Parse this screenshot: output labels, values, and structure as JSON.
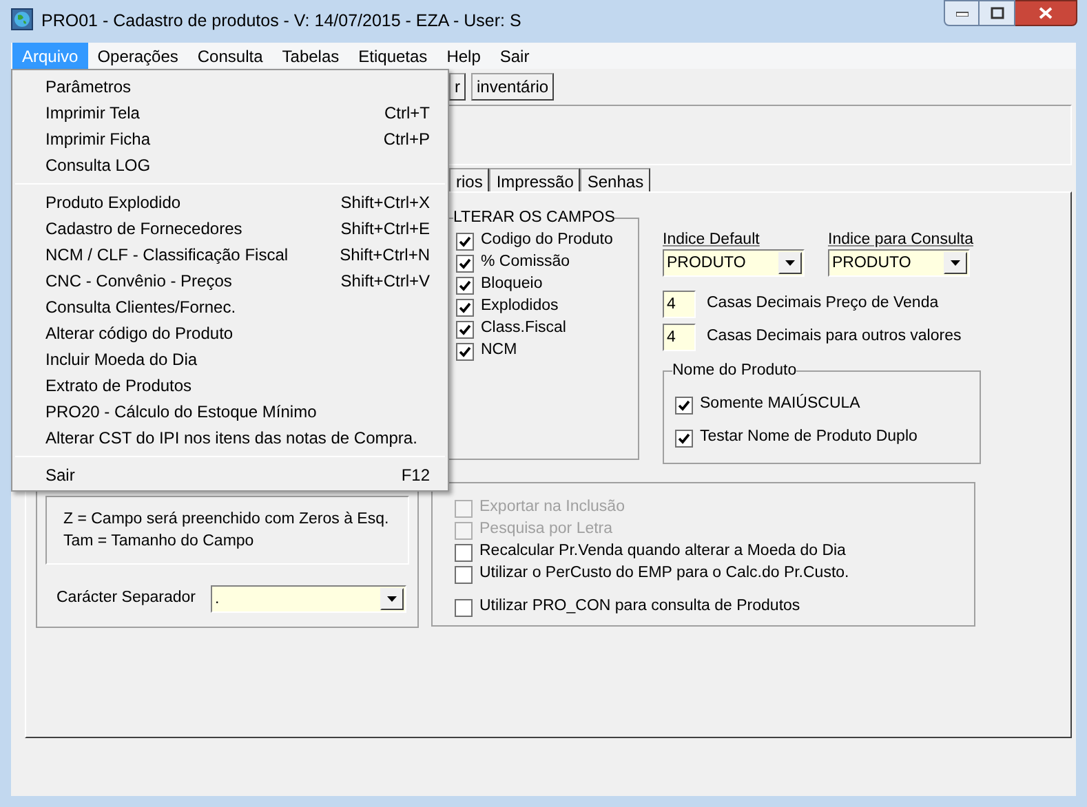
{
  "window": {
    "title": "PRO01 - Cadastro de produtos - V: 14/07/2015 - EZA - User: S"
  },
  "menubar": [
    {
      "label": "Arquivo",
      "selected": true
    },
    {
      "label": "Operações",
      "selected": false
    },
    {
      "label": "Consulta",
      "selected": false
    },
    {
      "label": "Tabelas",
      "selected": false
    },
    {
      "label": "Etiquetas",
      "selected": false
    },
    {
      "label": "Help",
      "selected": false
    },
    {
      "label": "Sair",
      "selected": false
    }
  ],
  "menu": {
    "sections": [
      [
        {
          "label": "Parâmetros"
        },
        {
          "label": "Imprimir Tela",
          "shortcut": "Ctrl+T"
        },
        {
          "label": "Imprimir Ficha",
          "shortcut": "Ctrl+P"
        },
        {
          "label": "Consulta LOG"
        }
      ],
      [
        {
          "label": "Produto Explodido",
          "shortcut": "Shift+Ctrl+X"
        },
        {
          "label": "Cadastro de Fornecedores",
          "shortcut": "Shift+Ctrl+E"
        },
        {
          "label": "NCM / CLF - Classificação Fiscal",
          "shortcut": "Shift+Ctrl+N"
        },
        {
          "label": "CNC - Convênio - Preços",
          "shortcut": "Shift+Ctrl+V"
        },
        {
          "label": "Consulta Clientes/Fornec."
        },
        {
          "label": "Alterar código do Produto"
        },
        {
          "label": "Incluir Moeda do Dia"
        },
        {
          "label": "Extrato de Produtos"
        },
        {
          "label": "PRO20 - Cálculo do Estoque Mínimo"
        },
        {
          "label": "Alterar CST do IPI nos itens das notas de Compra."
        }
      ],
      [
        {
          "label": "Sair",
          "shortcut": "F12"
        }
      ]
    ]
  },
  "toolbar": [
    "r",
    "inventário"
  ],
  "tabs": [
    {
      "label": "rios",
      "selected": false
    },
    {
      "label": "Impressão",
      "selected": false
    },
    {
      "label": "Senhas",
      "selected": false
    }
  ],
  "alterar_group": {
    "title": "LTERAR OS CAMPOS",
    "options": [
      {
        "label": "Codigo do Produto",
        "checked": true
      },
      {
        "label": "% Comissão",
        "checked": true
      },
      {
        "label": "Bloqueio",
        "checked": true
      },
      {
        "label": "Explodidos",
        "checked": true
      },
      {
        "label": "Class.Fiscal",
        "checked": true
      },
      {
        "label": "NCM",
        "checked": true
      }
    ]
  },
  "indexes": [
    {
      "label": "Indice Default",
      "value": "PRODUTO"
    },
    {
      "label": "Indice para Consulta",
      "value": "PRODUTO"
    }
  ],
  "decimals": [
    {
      "value": "4",
      "label": "Casas Decimais Preço de Venda"
    },
    {
      "value": "4",
      "label": "Casas Decimais para outros valores"
    }
  ],
  "nome_group": {
    "title": "Nome do Produto",
    "options": [
      {
        "label": "Somente MAIÚSCULA",
        "checked": true
      },
      {
        "label": "Testar Nome de Produto Duplo",
        "checked": true
      }
    ]
  },
  "legend": [
    "Z = Campo será preenchido com Zeros à Esq.",
    "Tam = Tamanho do Campo"
  ],
  "separator": {
    "label": "Carácter Separador",
    "value": "."
  },
  "options": [
    {
      "label": "Exportar na Inclusão",
      "checked": false,
      "disabled": true
    },
    {
      "label": "Pesquisa por Letra",
      "checked": false,
      "disabled": true
    },
    {
      "label": "Recalcular Pr.Venda quando alterar a Moeda do Dia",
      "checked": false,
      "disabled": false
    },
    {
      "label": "Utilizar o PerCusto do EMP para o Calc.do Pr.Custo.",
      "checked": false,
      "disabled": false
    },
    {
      "label": "Utilizar PRO_CON para consulta de Produtos",
      "checked": false,
      "disabled": false
    }
  ]
}
